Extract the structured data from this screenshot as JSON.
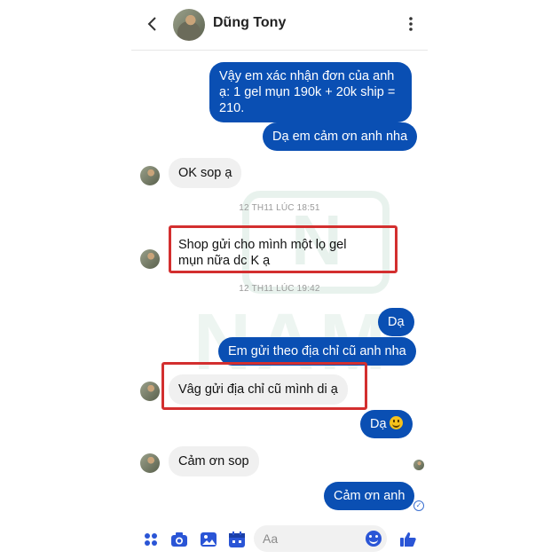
{
  "header": {
    "name": "Dũng Tony",
    "back_icon": "back-arrow-icon",
    "more_icon": "vertical-dots-icon"
  },
  "messages": [
    {
      "id": "m1",
      "dir": "out",
      "text": "Vậy em xác nhận đơn của anh ạ: 1 gel mụn 190k + 20k ship = 210."
    },
    {
      "id": "m2",
      "dir": "out",
      "text": "Dạ em cảm ơn anh nha"
    },
    {
      "id": "m3",
      "dir": "in",
      "text": "OK sop ạ"
    },
    {
      "id": "m4",
      "dir": "in",
      "text": "Shop gửi cho mình một lọ gel mụn nữa dc K ạ"
    },
    {
      "id": "m5",
      "dir": "out",
      "text": "Dạ"
    },
    {
      "id": "m6",
      "dir": "out",
      "text": "Em gửi theo địa chỉ cũ anh nha"
    },
    {
      "id": "m7",
      "dir": "in",
      "text": "Vâg gửi địa chỉ cũ mình di ạ"
    },
    {
      "id": "m8",
      "dir": "out",
      "text": "Dạ",
      "emoji": "slightly-smiling-face"
    },
    {
      "id": "m9",
      "dir": "in",
      "text": "Cảm ơn sop"
    },
    {
      "id": "m10",
      "dir": "out",
      "text": "Cảm ơn anh"
    }
  ],
  "timestamps": [
    "12 TH11 LÚC 18:51",
    "12 TH11 LÚC 19:42"
  ],
  "watermark": {
    "text": "NAM",
    "logo_letter": "N"
  },
  "composer": {
    "placeholder": "Aa",
    "icons": [
      "apps-dots-icon",
      "camera-icon",
      "image-icon",
      "calendar-icon",
      "emoji-icon",
      "thumbs-up-icon"
    ]
  },
  "colors": {
    "outgoing": "#0a4fb3",
    "incoming": "#f0f0f0",
    "highlight": "#d32f2f",
    "accent": "#2a55d6"
  }
}
